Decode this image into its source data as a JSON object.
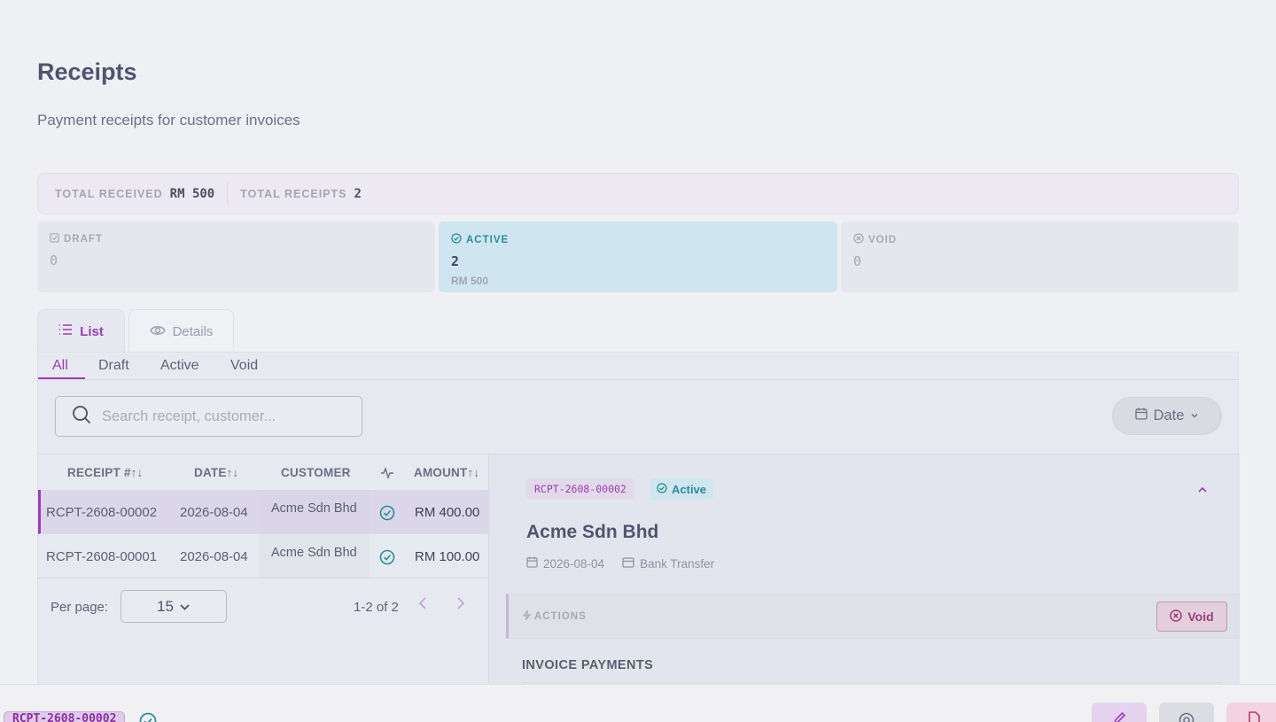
{
  "page": {
    "title": "Receipts",
    "subtitle": "Payment receipts for customer invoices"
  },
  "summary": {
    "total_received_label": "TOTAL RECEIVED",
    "total_received_value": "RM 500",
    "total_receipts_label": "TOTAL RECEIPTS",
    "total_receipts_value": "2"
  },
  "status_cards": [
    {
      "label": "DRAFT",
      "count": "0",
      "amount": ""
    },
    {
      "label": "ACTIVE",
      "count": "2",
      "amount": "RM 500"
    },
    {
      "label": "VOID",
      "count": "0",
      "amount": ""
    }
  ],
  "view_tabs": [
    {
      "label": "List",
      "icon": "list-icon"
    },
    {
      "label": "Details",
      "icon": "eye-icon"
    }
  ],
  "filter_tabs": [
    "All",
    "Draft",
    "Active",
    "Void"
  ],
  "search": {
    "placeholder": "Search receipt, customer..."
  },
  "date_filter": {
    "label": "Date"
  },
  "table": {
    "headers": {
      "receipt": "RECEIPT #",
      "date": "DATE",
      "customer": "CUSTOMER",
      "amount": "AMOUNT"
    },
    "rows": [
      {
        "receipt": "RCPT-2608-00002",
        "date": "2026-08-04",
        "customer": "Acme Sdn Bhd",
        "amount": "RM 400.00"
      },
      {
        "receipt": "RCPT-2608-00001",
        "date": "2026-08-04",
        "customer": "Acme Sdn Bhd",
        "amount": "RM 100.00"
      }
    ]
  },
  "pagination": {
    "per_page_label": "Per page:",
    "per_page_value": "15",
    "range": "1-2 of 2"
  },
  "detail": {
    "receipt_id": "RCPT-2608-00002",
    "status": "Active",
    "customer": "Acme Sdn Bhd",
    "date": "2026-08-04",
    "method": "Bank Transfer",
    "actions_label": "ACTIONS",
    "void_label": "Void",
    "invoice_payments_label": "INVOICE PAYMENTS"
  },
  "bottom_bar": {
    "receipt_id": "RCPT-2608-00002"
  },
  "colors": {
    "accent": "#9b3db4",
    "active": "#2c8c98",
    "void": "#9b3d7a"
  }
}
